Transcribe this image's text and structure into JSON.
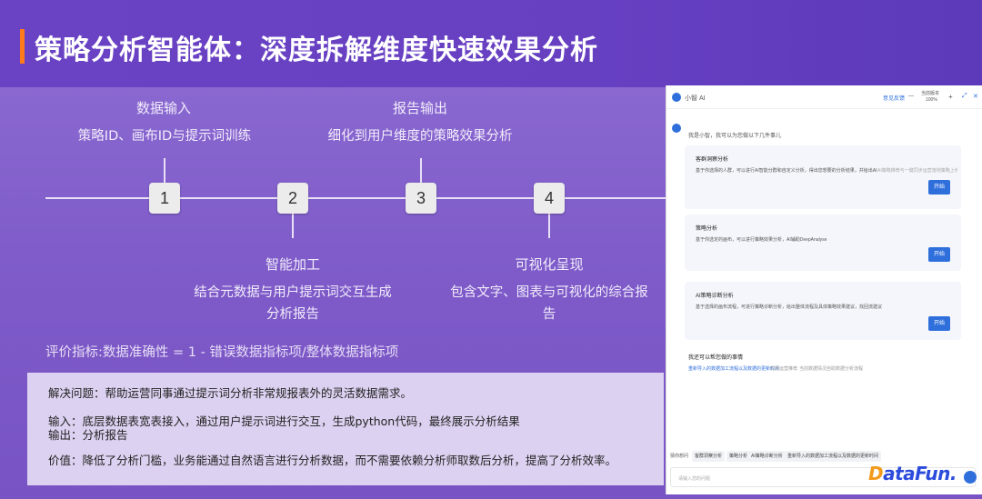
{
  "slide": {
    "title": "策略分析智能体：深度拆解维度快速效果分析"
  },
  "timeline": {
    "nodes": [
      "1",
      "2",
      "3",
      "4"
    ],
    "step1": {
      "title": "数据输入",
      "desc": "策略ID、画布ID与提示词训练"
    },
    "step2": {
      "title": "智能加工",
      "desc": "结合元数据与用户提示词交互生成分析报告"
    },
    "step3": {
      "title": "报告输出",
      "desc": "细化到用户维度的策略效果分析"
    },
    "step4": {
      "title": "可视化呈现",
      "desc": "包含文字、图表与可视化的综合报告"
    }
  },
  "metric": "评价指标:数据准确性 = 1 - 错误数据指标项/整体数据指标项",
  "summary": {
    "problem": "解决问题：帮助运营同事通过提示词分析非常规报表外的灵活数据需求。",
    "input": "输入：底层数据表宽表接入，通过用户提示词进行交互，生成python代码，最终展示分析结果",
    "output": "输出：分析报告",
    "value": "价值：降低了分析门槛，业务能通过自然语言进行分析数据，而不需要依赖分析师取数后分析，提高了分析效率。"
  },
  "chat": {
    "app_name": "小智 AI",
    "header_link": "意见反馈",
    "header_status": "当前版本",
    "header_percent": "100%",
    "greeting": "我是小智，我可以为您做以下几件事儿",
    "cards": [
      {
        "title": "客群洞察分析",
        "desc": "基于你选择的人群，可以进行AI智能分群和自定义分析，得出您想要的分析结果，并给出AI建议。",
        "note": "AI策略推荐与一键同步运营落地策略上线",
        "button": "开始"
      },
      {
        "title": "策略分析",
        "desc": "基于你选定的画布，可以进行策略效果分析，AI辅助DeepAnalyse",
        "button": "开始"
      },
      {
        "title": "AI策略诊断分析",
        "desc": "基于选择的画布流程，可进行策略诊断分析，给出整体流程及具体策略效果建议，找回流建议",
        "button": "开始"
      }
    ],
    "followup_title": "我还可以帮您做的事情",
    "followup_items": [
      "重新导入的数据加工流程以及数据的更新时间",
      "优惠运营推荐",
      "当前数据情况",
      "自助数据分析流程"
    ],
    "quick_label": "猜你想问",
    "quick_pills": [
      "客群洞察分析",
      "策略分析",
      "AI策略诊断分析",
      "重新导入的数据加工流程以及数据的更新时间"
    ],
    "input_placeholder": "请输入您的问题",
    "brand": "DataFun",
    "brand_initial": "D",
    "brand_rest": "ataFun."
  },
  "colors": {
    "accent": "#ff7a1a",
    "primary_blue": "#2f6fdc",
    "brand_blue": "#2b4bdc",
    "brand_orange": "#f29a1c"
  }
}
